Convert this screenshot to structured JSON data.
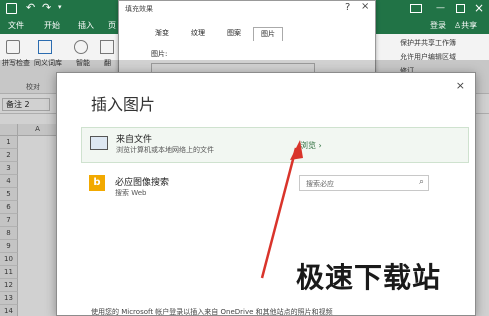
{
  "excel": {
    "title_right": {
      "login": "登录",
      "share": "共享"
    },
    "tabs": [
      "文件",
      "开始",
      "插入",
      "页"
    ],
    "ribbon_groups": {
      "spell_check": "拼写检查",
      "thesaurus": "同义词库",
      "smart": "智能",
      "translate": "翻",
      "proofing": "校对",
      "protect_share": "保护并共享工作簿",
      "allow_edit": "允许用户编辑区域",
      "track_changes": "修订"
    },
    "name_box": "备注 2",
    "columns": [
      "A"
    ],
    "rows": [
      "1",
      "2",
      "3",
      "4",
      "5",
      "6",
      "7",
      "8",
      "9",
      "10",
      "11",
      "12",
      "13",
      "14",
      "15"
    ]
  },
  "fill_dialog": {
    "title": "填充效果",
    "tabs": [
      "渐变",
      "纹理",
      "图案",
      "图片"
    ],
    "active_tab": "图片",
    "picture_label": "图片:"
  },
  "insert_picture": {
    "title": "插入图片",
    "close": "×",
    "from_file": {
      "title": "来自文件",
      "subtitle": "浏览计算机或本地网络上的文件",
      "action": "浏览"
    },
    "bing": {
      "title": "必应图像搜索",
      "subtitle": "搜索 Web",
      "search_placeholder": "搜索必应"
    },
    "footer_partial": "使用您的 Microsoft 帐户登录以插入来自 OneDrive 和其他站点的照片和视频"
  },
  "watermark": "极速下载站",
  "accent_colors": {
    "excel_green": "#217346",
    "arrow_red": "#d9342b"
  }
}
